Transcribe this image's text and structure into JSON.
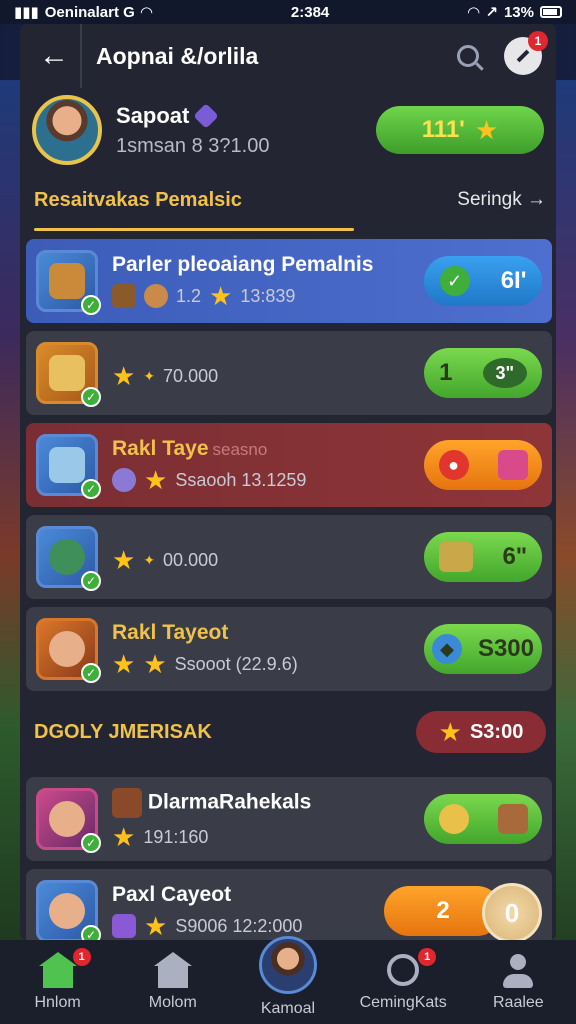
{
  "status_bar": {
    "carrier": "Oeninalart G",
    "time": "2:384",
    "battery": "13%"
  },
  "header": {
    "title": "Aopnai &/orlila",
    "notif_count": "1"
  },
  "profile": {
    "name": "Sapoat",
    "subtitle": "1smsan 8 3?1.00",
    "score": "111'"
  },
  "section": {
    "title": "Resaitvakas Pemalsic",
    "link": "Seringk →"
  },
  "cards": [
    {
      "title": "Parler pleoaiang Pemalnis",
      "ghost": "",
      "meta_a": "1.2",
      "meta_b": "13:839",
      "pill_value": "6I'"
    },
    {
      "title": "",
      "ghost": "",
      "meta_a": "",
      "meta_b": "70.000",
      "pill_value": "3\"",
      "pill_left": "1"
    },
    {
      "title": "Rakl Taye",
      "ghost": "seasno",
      "meta_a": "",
      "meta_b": "Ssaooh 13.1259",
      "pill_value": ""
    },
    {
      "title": "",
      "ghost": "",
      "meta_a": "",
      "meta_b": "00.000",
      "pill_value": "6\""
    },
    {
      "title": "Rakl Tayeot",
      "ghost": "",
      "meta_a": "",
      "meta_b": "Ssooot (22.9.6)",
      "pill_value": "S300"
    }
  ],
  "daily": {
    "title": "DGOLY JMERISAK",
    "pill_value": "S3:00"
  },
  "cards2": [
    {
      "title": "DlarmaRahekals",
      "meta_b": "191:160",
      "pill_value": ""
    },
    {
      "title": "Paxl Cayeot",
      "meta_b": "S9006 12:2:000",
      "pill_value": "2",
      "fab": "0"
    }
  ],
  "bottom_nav": [
    {
      "label": "Hnlom",
      "badge": "1"
    },
    {
      "label": "Molom",
      "badge": ""
    },
    {
      "label": "Kamoal",
      "badge": ""
    },
    {
      "label": "CemingKats",
      "badge": "1"
    },
    {
      "label": "Raalee",
      "badge": ""
    }
  ]
}
